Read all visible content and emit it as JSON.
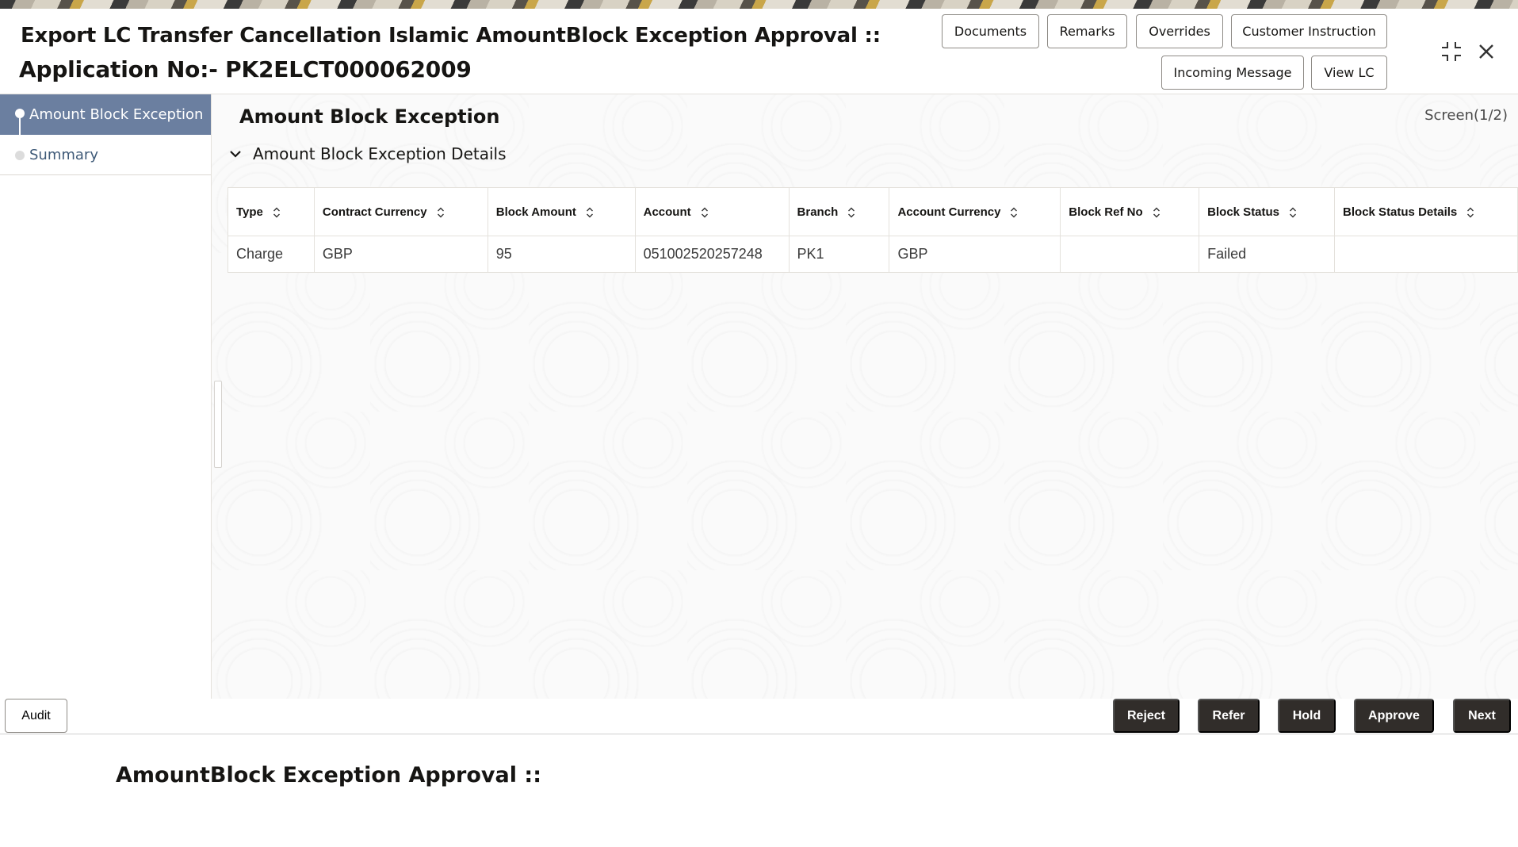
{
  "header": {
    "title_line1": "Export LC Transfer Cancellation Islamic AmountBlock Exception Approval ::",
    "title_line2": "Application No:- PK2ELCT000062009",
    "buttons": {
      "documents": "Documents",
      "remarks": "Remarks",
      "overrides": "Overrides",
      "customer_instruction": "Customer Instruction",
      "incoming_message": "Incoming Message",
      "view_lc": "View LC"
    },
    "icons": {
      "maximize": "minimize-expand-icon",
      "close": "close-icon"
    }
  },
  "sidebar": {
    "items": [
      {
        "label": "Amount Block Exception",
        "active": true
      },
      {
        "label": "Summary",
        "active": false
      }
    ]
  },
  "main": {
    "title": "Amount Block Exception",
    "screen_indicator": "Screen(1/2)",
    "section_title": "Amount Block Exception Details",
    "table": {
      "columns": [
        "Type",
        "Contract Currency",
        "Block Amount",
        "Account",
        "Branch",
        "Account Currency",
        "Block Ref No",
        "Block Status",
        "Block Status Details"
      ],
      "rows": [
        [
          "Charge",
          "GBP",
          "95",
          "051002520257248",
          "PK1",
          "GBP",
          "",
          "Failed",
          ""
        ]
      ]
    }
  },
  "footer": {
    "audit": "Audit",
    "reject": "Reject",
    "refer": "Refer",
    "hold": "Hold",
    "approve": "Approve",
    "next": "Next"
  },
  "bottom": {
    "title": "AmountBlock Exception Approval ::"
  },
  "colors": {
    "active_nav": "#6b7fa0",
    "action_button": "#312d2a",
    "nav_link": "#3f5a78"
  }
}
